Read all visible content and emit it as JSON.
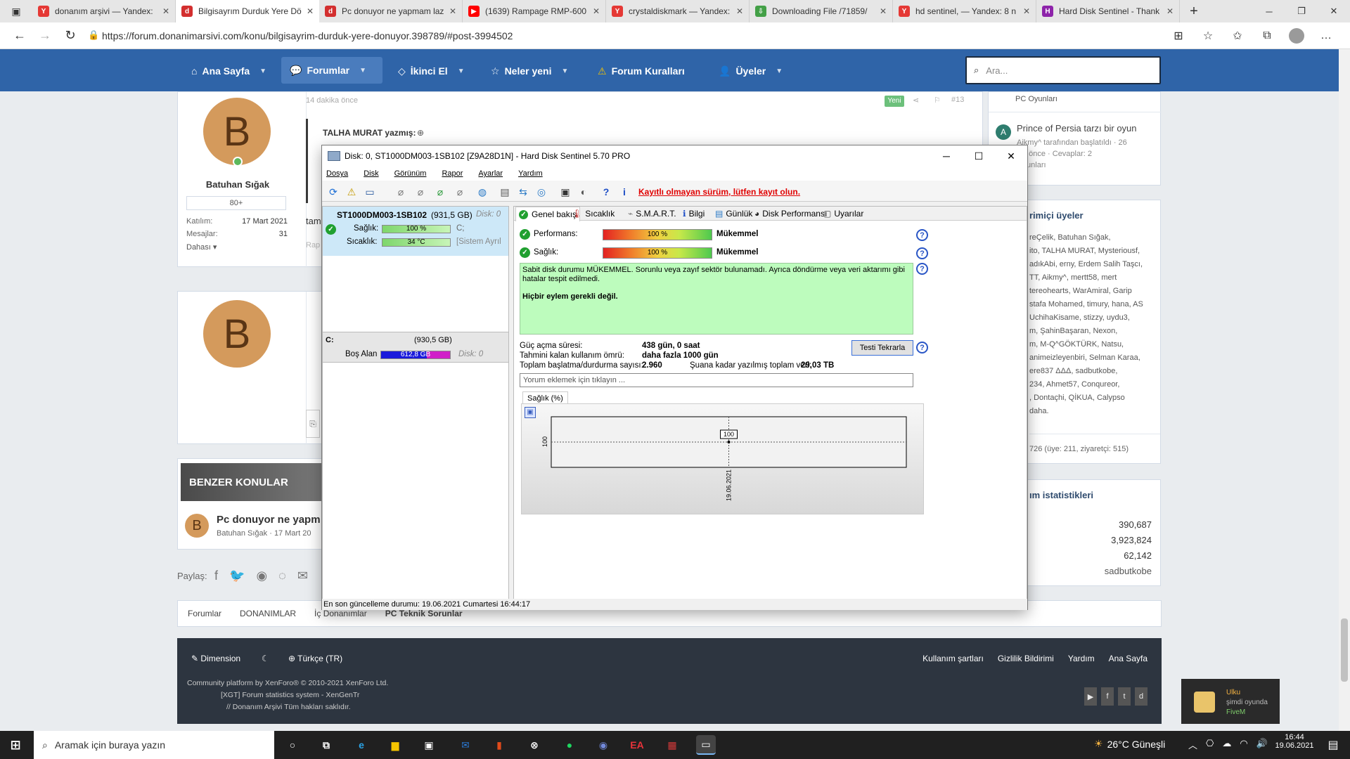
{
  "browser": {
    "tabs": [
      {
        "title": "donanım arşivi — Yandex:",
        "color": "#e53935",
        "glyph": "Y"
      },
      {
        "title": "Bilgisayrım Durduk Yere Dö",
        "color": "#d32f2f",
        "glyph": "d"
      },
      {
        "title": "Pc donuyor ne yapmam laz",
        "color": "#d32f2f",
        "glyph": "d"
      },
      {
        "title": "(1639) Rampage RMP-600",
        "color": "#ff0000",
        "glyph": "▶"
      },
      {
        "title": "crystaldiskmark — Yandex:",
        "color": "#e53935",
        "glyph": "Y"
      },
      {
        "title": "Downloading File /71859/",
        "color": "#43a047",
        "glyph": "⇩"
      },
      {
        "title": "hd sentinel, — Yandex: 8 n",
        "color": "#e53935",
        "glyph": "Y"
      },
      {
        "title": "Hard Disk Sentinel - Thank",
        "color": "#8e24aa",
        "glyph": "H"
      }
    ],
    "url": "https://forum.donanimarsivi.com/konu/bilgisayrim-durduk-yere-donuyor.398789/#post-3994502"
  },
  "nav": {
    "items": [
      "Ana Sayfa",
      "Forumlar",
      "İkinci El",
      "Neler yeni",
      "Forum Kuralları",
      "Üyeler"
    ],
    "search_placeholder": "Ara..."
  },
  "post": {
    "time": "14 dakika önce",
    "badge": "Yeni",
    "number": "#13",
    "quote_author": "TALHA MURAT yazmış:",
    "text_fragment": "tam",
    "author": {
      "initial": "B",
      "name": "Batuhan Sığak",
      "rank": "80+",
      "joined_label": "Katılım:",
      "joined": "17 Mart 2021",
      "messages_label": "Mesajlar:",
      "messages": "31",
      "more": "Dahası ▾"
    },
    "reply_initial": "B"
  },
  "similar": {
    "header": "BENZER KONULAR",
    "item_title": "Pc donuyor ne yapm",
    "item_meta": "Batuhan Sığak · 17 Mart 20"
  },
  "share": {
    "label": "Paylaş:"
  },
  "breadcrumb": [
    "Forumlar",
    "DONANIMLAR",
    "İç Donanımlar",
    "PC Teknik Sorunlar"
  ],
  "footer": {
    "style": "Dimension",
    "language": "Türkçe (TR)",
    "links": [
      "Kullanım şartları",
      "Gizlilik Bildirimi",
      "Yardım",
      "Ana Sayfa"
    ],
    "line1": "Community platform by XenForo® © 2010-2021 XenForo Ltd.",
    "line2": "[XGT] Forum statistics system - XenGenTr",
    "line3": "//    Donanım Arşivi Tüm hakları saklıdır."
  },
  "sidebar": {
    "thread1": "PC Oyunları",
    "thread2_title": "Prince of Persia tarzı bir oyun",
    "thread2_meta1": "Aikmy^ tarafından başlatıldı · 26",
    "thread2_meta2": "ika önce · Cevaplar: 2",
    "thread2_meta3": "Oyunları",
    "thread2_avatar": "A",
    "online_header": "rimiçi üyeler",
    "online_lines": [
      "reÇelik, Batuhan Sığak,",
      "ito, TALHA MURAT, Mysteriousf,",
      "adıkAbi, erny, Erdem Salih Taşcı,",
      "TT, Aikmy^, mertt58, mert",
      "tereohearts, WarAmiral, Garip",
      "stafa Mohamed, timury, hana, AS",
      "UchihaKisame, stizzy, uydu3,",
      "m, ŞahinBaşaran, Nexon,",
      "m, M-Q^GÖKTÜRK, Natsu,",
      "animeizleyenbiri, Selman Karaa,",
      "ere837 ΔΔΔ, sadbutkobe,",
      "234, Ahmet57, Conqureor,",
      ", Dontaçhi, QİKUA, Calypso",
      "daha."
    ],
    "online_total": "726 (üye: 211, ziyaretçi: 515)",
    "stats_header": "ım istatistikleri",
    "stats": [
      "390,687",
      "3,923,824",
      "62,142",
      "sadbutkobe"
    ]
  },
  "notification": {
    "title": "Ulku",
    "sub": "şimdi oyunda",
    "game": "FiveM"
  },
  "taskbar": {
    "search": "Aramak için buraya yazın",
    "weather": "26°C  Güneşli",
    "time": "16:44",
    "date": "19.06.2021"
  },
  "hds": {
    "title": "Disk: 0, ST1000DM003-1SB102 [Z9A28D1N]  -  Hard Disk Sentinel 5.70 PRO",
    "menu": [
      "Dosya",
      "Disk",
      "Görünüm",
      "Rapor",
      "Ayarlar",
      "Yardım"
    ],
    "unregistered": "Kayıtlı olmayan sürüm, lütfen kayıt olun.",
    "disk": {
      "model": "ST1000DM003-1SB102",
      "size": "(931,5 GB)",
      "disk_no": "Disk: 0",
      "health_label": "Sağlık:",
      "health": "100 %",
      "health_drive": "C;",
      "temp_label": "Sıcaklık:",
      "temp": "34 °C",
      "temp_note": "[Sistem Ayrıl",
      "health_pct": 100
    },
    "volume": {
      "letter": "C:",
      "size": "(930,5 GB)",
      "free_label": "Boş Alan",
      "free": "612,8 GB",
      "disk_no": "Disk: 0",
      "free_fraction": 0.659
    },
    "tabs": [
      "Genel bakış",
      "Sıcaklık",
      "S.M.A.R.T.",
      "Bilgi",
      "Günlük",
      "Disk Performansı",
      "Uyarılar"
    ],
    "performance_label": "Performans:",
    "performance": "100 %",
    "performance_rating": "Mükemmel",
    "health_label": "Sağlık:",
    "health": "100 %",
    "health_rating": "Mükemmel",
    "message": "Sabit disk durumu MÜKEMMEL. Sorunlu veya zayıf sektör bulunamadı. Ayrıca döndürme veya veri aktarımı gibi hatalar tespit edilmedi.",
    "action": "Hiçbir eylem gerekli değil.",
    "power_on_label": "Güç açma süresi:",
    "power_on": "438 gün, 0 saat",
    "lifetime_label": "Tahmini kalan kullanım ömrü:",
    "lifetime": "daha fazla 1000 gün",
    "startstop_label": "Toplam başlatma/durdurma sayısı:",
    "startstop": "2.960",
    "written_label": "Şuana kadar yazılmış toplam veri:",
    "written": "29,03 TB",
    "retest": "Testi Tekrarla",
    "comment_placeholder": "Yorum eklemek için tıklayın ...",
    "chart_tab": "Sağlık (%)",
    "status": "En son güncelleme durumu: 19.06.2021 Cumartesi 16:44:17"
  },
  "chart_data": {
    "type": "line",
    "title": "Sağlık (%)",
    "x": [
      "19.06.2021"
    ],
    "series": [
      {
        "values": [
          100
        ]
      }
    ],
    "ylabel": "",
    "y_tick": "100",
    "data_label": "100"
  }
}
